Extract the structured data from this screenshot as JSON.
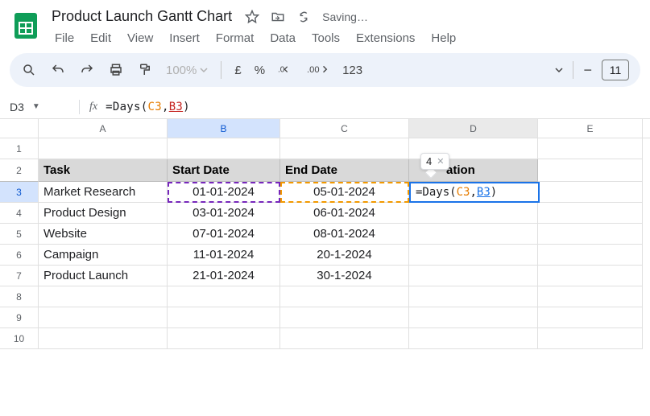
{
  "header": {
    "doc_title": "Product Launch Gantt Chart",
    "saving_label": "Saving…"
  },
  "menu": [
    "File",
    "Edit",
    "View",
    "Insert",
    "Format",
    "Data",
    "Tools",
    "Extensions",
    "Help"
  ],
  "toolbar": {
    "zoom": "100%",
    "currency": "£",
    "percent": "%",
    "dec_dec": ".0",
    "dec_inc": ".00",
    "numfmt": "123",
    "font_size": "11"
  },
  "name_box": "D3",
  "formula": {
    "kw": "=Days",
    "ref1": "C3",
    "ref2": "B3"
  },
  "columns": [
    "A",
    "B",
    "C",
    "D",
    "E"
  ],
  "row_labels": [
    "1",
    "2",
    "3",
    "4",
    "5",
    "6",
    "7",
    "8",
    "9",
    "10"
  ],
  "headers": {
    "task": "Task",
    "start": "Start Date",
    "end": "End Date",
    "dur": "ation"
  },
  "rows": [
    {
      "task": "Market Research",
      "start": "01-01-2024",
      "end": "05-01-2024"
    },
    {
      "task": "Product Design",
      "start": "03-01-2024",
      "end": "06-01-2024"
    },
    {
      "task": "Website",
      "start": "07-01-2024",
      "end": "08-01-2024"
    },
    {
      "task": "Campaign",
      "start": "11-01-2024",
      "end": "20-1-2024"
    },
    {
      "task": "Product Launch",
      "start": "21-01-2024",
      "end": "30-1-2024"
    }
  ],
  "active_cell": {
    "kw": "=Days",
    "ref1": "C3",
    "ref2": "B3"
  },
  "hint": {
    "value": "4"
  }
}
